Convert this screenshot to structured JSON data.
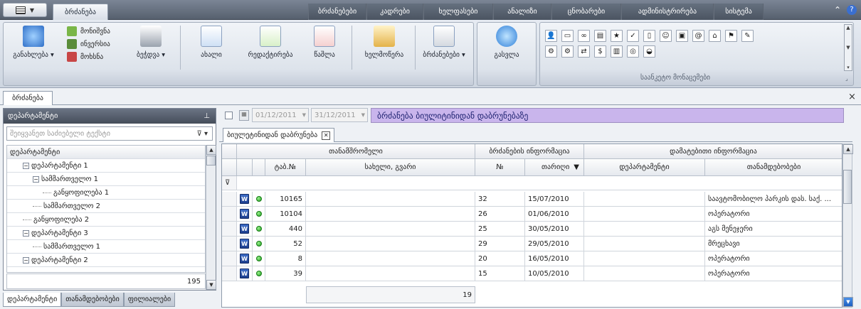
{
  "top_tabs": {
    "active": "ბრძანება",
    "items": [
      "ბრძანებები",
      "კადრები",
      "ხელფასები",
      "ანალიზი",
      "ცნობარები",
      "ადმინისტრირება",
      "სისტემა"
    ]
  },
  "top_right": {
    "collapse_icon": "double-chevron-up-icon",
    "help_icon": "help-circle-icon"
  },
  "ribbon": {
    "refresh": {
      "label": "განახლება"
    },
    "mark": {
      "items": [
        "მონიშვნა",
        "ინვერსია",
        "მოხსნა"
      ]
    },
    "print": {
      "label": "ბეჭდვა"
    },
    "new": {
      "label": "ახალი"
    },
    "edit": {
      "label": "რედაქტირება"
    },
    "delete": {
      "label": "წაშლა"
    },
    "sign": {
      "label": "ხელმოწერა"
    },
    "orders": {
      "label": "ბრძანებები"
    },
    "exit": {
      "label": "გასვლა"
    },
    "gallery": {
      "caption": "საანკეტო მონაცემები"
    }
  },
  "doc_tab": {
    "label": "ბრძანება",
    "close": "×"
  },
  "left_panel": {
    "title": "დეპარტამენტი",
    "pin": "ᵖ",
    "filter_placeholder": "შეიყვანეთ საძიებელი ტექსტი",
    "tree_header": "დეპარტამენტი",
    "tree": [
      {
        "label": "დეპარტამენტი 1",
        "level": 1,
        "toggle": "−"
      },
      {
        "label": "სამმართველო 1",
        "level": 2,
        "toggle": "−"
      },
      {
        "label": "განყოფილება 1",
        "level": 3,
        "toggle": ""
      },
      {
        "label": "სამმართველო 2",
        "level": 2,
        "toggle": ""
      },
      {
        "label": "განყოფილება 2",
        "level": 1,
        "toggle": ""
      },
      {
        "label": "დეპარტამენტი 3",
        "level": 1,
        "toggle": "−"
      },
      {
        "label": "სამმართველო 1",
        "level": 2,
        "toggle": ""
      },
      {
        "label": "დეპარტამენტი 2",
        "level": 1,
        "toggle": "−"
      }
    ],
    "count": "195",
    "bottom_tabs": [
      "დეპარტამენტი",
      "თანამდებობები",
      "ფილიალები"
    ]
  },
  "filter_bar": {
    "date_from": "01/12/2011",
    "date_to": "31/12/2011",
    "banner": "ბრძანება ბიულიტინიდან დაბრუნებაზე"
  },
  "subtab": {
    "label": "ბიულეტინიდან დაბრუნება",
    "close": "✕"
  },
  "grid": {
    "groups": [
      "თანამშრომელი",
      "ბრძანების ინფორმაცია",
      "დამატებითი ინფორმაცია"
    ],
    "columns": [
      "ტაბ.№",
      "სახელი, გვარი",
      "№",
      "თარიღი",
      "დეპარტამენტი",
      "თანამდებობები"
    ],
    "sort_indicator": "▼",
    "filter_icon": "ᵠ",
    "rows": [
      {
        "tab": "10165",
        "name": "",
        "num": "32",
        "date": "15/07/2010",
        "dept": "",
        "position": "საავტომობილო პარკის დას. საქ. ..."
      },
      {
        "tab": "10104",
        "name": "",
        "num": "26",
        "date": "01/06/2010",
        "dept": "",
        "position": "ოპერატორი"
      },
      {
        "tab": "440",
        "name": "",
        "num": "25",
        "date": "30/05/2010",
        "dept": "",
        "position": "აგს მენეჯერი"
      },
      {
        "tab": "52",
        "name": "",
        "num": "29",
        "date": "29/05/2010",
        "dept": "",
        "position": "მრეცხავი"
      },
      {
        "tab": "8",
        "name": "",
        "num": "20",
        "date": "16/05/2010",
        "dept": "",
        "position": "ოპერატორი"
      },
      {
        "tab": "39",
        "name": "",
        "num": "15",
        "date": "10/05/2010",
        "dept": "",
        "position": "ოპერატორი"
      }
    ],
    "footer_count": "19"
  },
  "colors": {
    "accent": "#c9b5ec",
    "header": "#454d5a"
  }
}
